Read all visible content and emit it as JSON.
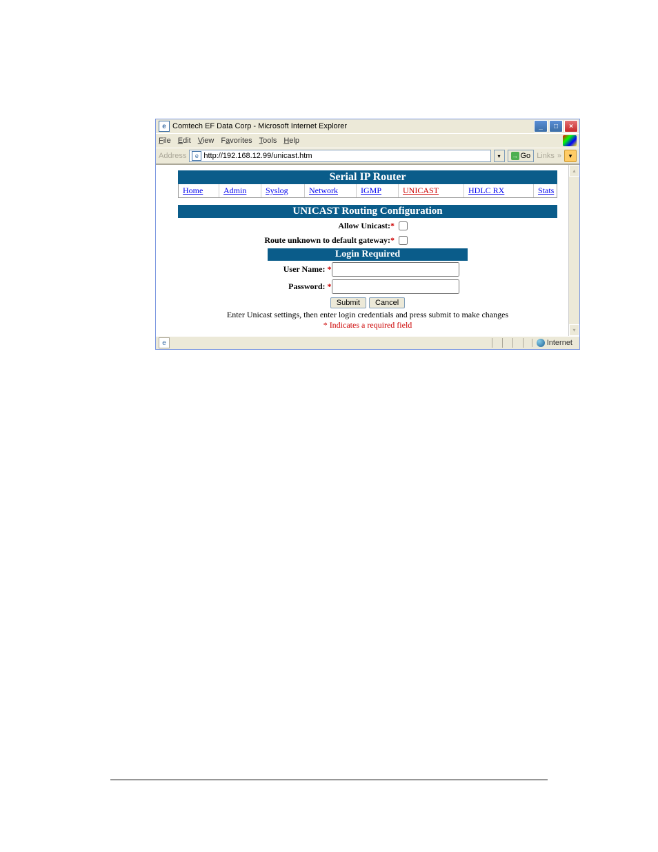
{
  "window": {
    "title": "Comtech EF Data Corp - Microsoft Internet Explorer"
  },
  "menu": {
    "file": "File",
    "edit": "Edit",
    "view": "View",
    "favorites": "Favorites",
    "tools": "Tools",
    "help": "Help"
  },
  "address": {
    "label": "Address",
    "url": "http://192.168.12.99/unicast.htm",
    "go": "Go",
    "links": "Links"
  },
  "page": {
    "title": "Serial IP Router",
    "nav": {
      "home": "Home",
      "admin": "Admin",
      "syslog": "Syslog",
      "network": "Network",
      "igmp": "IGMP",
      "unicast": "UNICAST",
      "hdlcrx": "HDLC RX",
      "stats": "Stats"
    },
    "section_title": "UNICAST Routing Configuration",
    "allow_unicast_label": "Allow Unicast:",
    "route_unknown_label": "Route unknown to default gateway:",
    "login_title": "Login Required",
    "username_label": "User Name: ",
    "password_label": "Password: ",
    "submit": "Submit",
    "cancel": "Cancel",
    "hint1": "Enter Unicast settings, then enter login credentials and press submit to make changes",
    "hint2": "* Indicates a required field"
  },
  "status": {
    "zone": "Internet"
  }
}
